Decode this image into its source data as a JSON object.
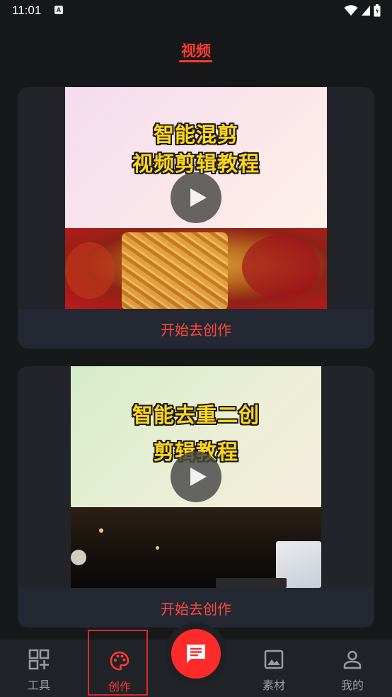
{
  "status_bar": {
    "time": "11:01",
    "notification_icon": "A"
  },
  "header": {
    "title": "视频"
  },
  "cards": [
    {
      "title_line_1": "智能混剪",
      "title_line_2": "视频剪辑教程",
      "action_label": "开始去创作"
    },
    {
      "title_line_1": "智能去重二创",
      "title_line_2": "剪辑教程",
      "action_label": "开始去创作"
    }
  ],
  "bottom_nav": {
    "items": [
      {
        "label": "工具",
        "icon": "grid-plus-icon"
      },
      {
        "label": "创作",
        "icon": "palette-icon"
      },
      {
        "label": "素材",
        "icon": "image-icon"
      },
      {
        "label": "我的",
        "icon": "person-icon"
      }
    ],
    "fab_icon": "message-icon"
  },
  "colors": {
    "accent": "#ff3b30",
    "background": "#17181a",
    "card": "#222429"
  }
}
